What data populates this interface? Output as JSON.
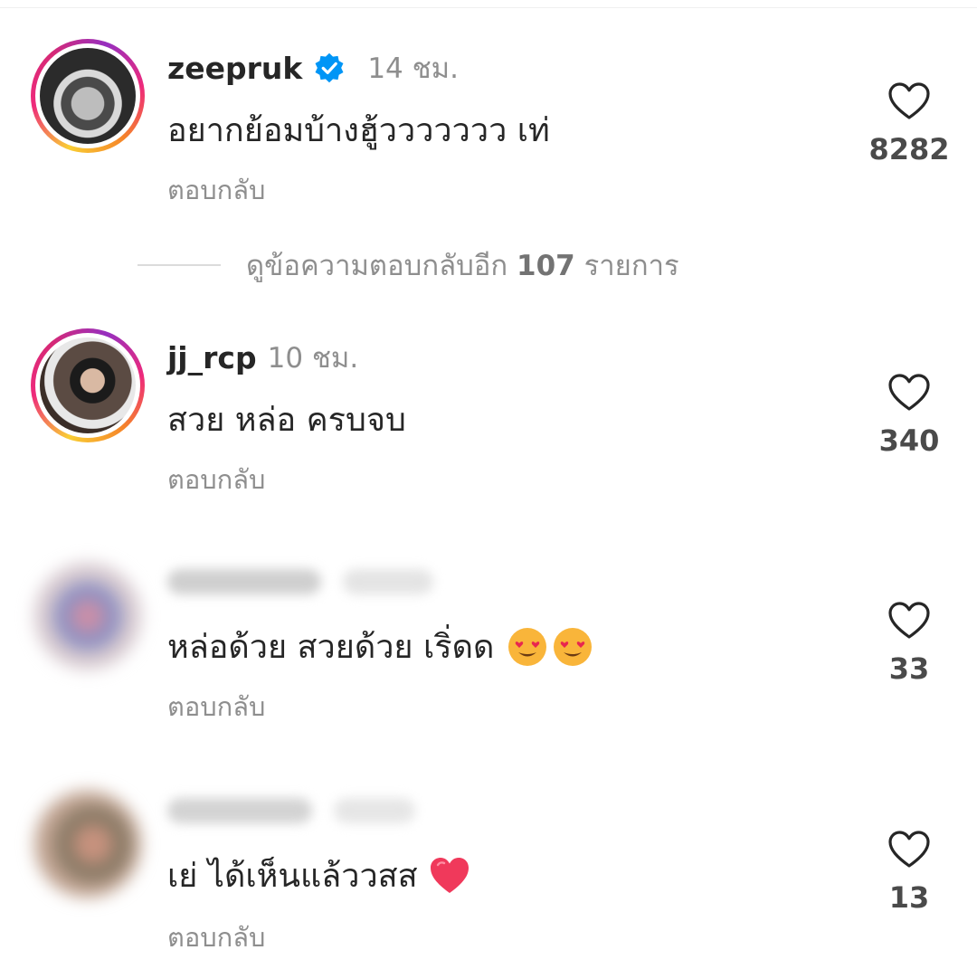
{
  "comments": [
    {
      "username": "zeepruk",
      "verified": true,
      "time": "14 ชม.",
      "text": "อยากย้อมบ้างฮู้ววววววว เท่",
      "reply_label": "ตอบกลับ",
      "likes": "8282",
      "avatar_icon": "profile-photo"
    },
    {
      "username": "jj_rcp",
      "verified": false,
      "time": "10 ชม.",
      "text": "สวย หล่อ ครบจบ",
      "reply_label": "ตอบกลับ",
      "likes": "340",
      "avatar_icon": "profile-photo"
    },
    {
      "username_blurred": true,
      "text": "หล่อด้วย สวยด้วย เริ่ดด",
      "emoji": [
        "heart-eyes-emoji",
        "heart-eyes-emoji"
      ],
      "reply_label": "ตอบกลับ",
      "likes": "33",
      "avatar_icon": "blurred-profile-photo"
    },
    {
      "username_blurred": true,
      "text": "เย่ ได้เห็นแล้ววสส",
      "emoji": [
        "red-heart-emoji"
      ],
      "reply_label": "ตอบกลับ",
      "likes": "13",
      "avatar_icon": "blurred-profile-photo"
    }
  ],
  "view_replies": {
    "prefix": "ดูข้อความตอบกลับอีก",
    "count": "107",
    "suffix": "รายการ"
  },
  "colors": {
    "text": "#262626",
    "muted": "#8e8e8e",
    "verified": "#0095f6",
    "story_ring_start": "#f9ce34",
    "story_ring_end": "#962fbf"
  }
}
